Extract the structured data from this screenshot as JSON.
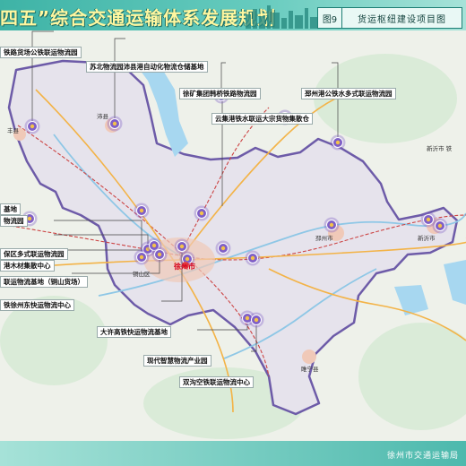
{
  "header": {
    "title": "四五”综合交通运输体系发展规划",
    "figure_number": "图9",
    "figure_title": "货运枢纽建设项目图"
  },
  "footer": {
    "issuer": "徐州市交通运输局"
  },
  "colors": {
    "frame": "#5ec3b8",
    "land": "#eef1ea",
    "region": "#e6e3ec",
    "region_border": "#6d5ba8",
    "water": "#a7d7f0",
    "hub_marker": "#7f5fc7",
    "city_center": "#e6514f",
    "label_text": "#111111",
    "highlight_text": "#d6001c"
  },
  "icons": {
    "hub": "logistics-hub-icon"
  },
  "map": {
    "hub_labels": [
      "铁路货场公铁联运物流园",
      "苏北物流园沛县港自动化物流仓储基地",
      "徐矿集团韩桥铁路物流园",
      "邳州港公铁水多式联运物流园",
      "云集港铁水联运大宗货物集散仓",
      "基地",
      "物流园",
      "保区多式联运物流园",
      "港木材集散中心",
      "联运物流基地（铜山货场）",
      "铁徐州东快运物流中心",
      "大许高铁快运物流基地",
      "现代智慧物流产业园",
      "双沟空铁联运物流中心"
    ],
    "places": [
      "沛县",
      "丰县",
      "邳州市",
      "新沂市",
      "新沂市 铁",
      "铜山区",
      "徐州市",
      "睢宁县"
    ]
  }
}
